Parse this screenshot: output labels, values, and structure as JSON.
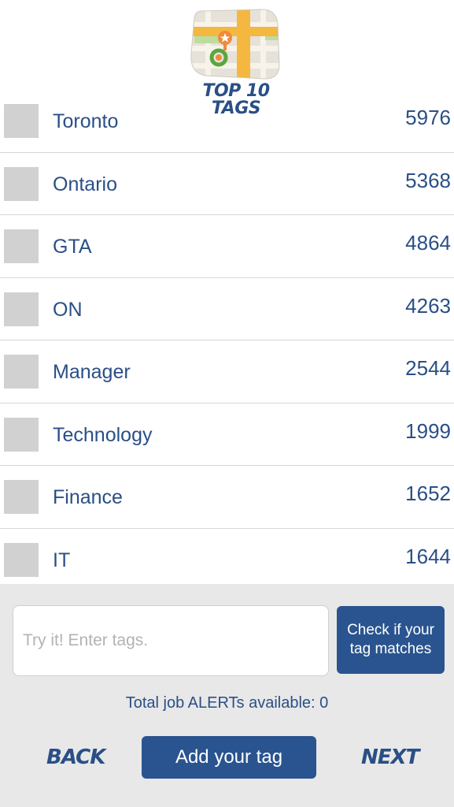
{
  "header": {
    "logo_line1": "TOP 10",
    "logo_line2": "TAGS"
  },
  "tags": [
    {
      "label": "Toronto",
      "count": "5976"
    },
    {
      "label": "Ontario",
      "count": "5368"
    },
    {
      "label": "GTA",
      "count": "4864"
    },
    {
      "label": "ON",
      "count": "4263"
    },
    {
      "label": "Manager",
      "count": "2544"
    },
    {
      "label": "Technology",
      "count": "1999"
    },
    {
      "label": "Finance",
      "count": "1652"
    },
    {
      "label": "IT",
      "count": "1644"
    }
  ],
  "form": {
    "input_placeholder": "Try it! Enter tags.",
    "input_value": "",
    "check_button": "Check if your tag matches",
    "alerts_text": "Total job ALERTs available: 0"
  },
  "nav": {
    "back": "BACK",
    "add": "Add your tag",
    "next": "NEXT"
  },
  "colors": {
    "primary": "#2a548f",
    "text": "#2a4f86",
    "panel_bg": "#e8e8e8",
    "checkbox": "#d1d1d1"
  }
}
